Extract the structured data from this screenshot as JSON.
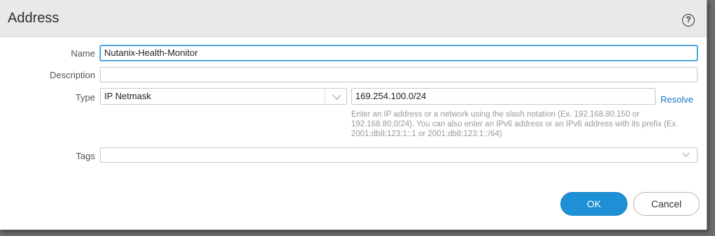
{
  "dialog": {
    "title": "Address",
    "help_glyph": "?"
  },
  "form": {
    "name_label": "Name",
    "name_value": "Nutanix-Health-Monitor",
    "description_label": "Description",
    "description_value": "",
    "type_label": "Type",
    "type_selected": "IP Netmask",
    "type_value": "169.254.100.0/24",
    "resolve_label": "Resolve",
    "hint": "Enter an IP address or a network using the slash notation (Ex. 192.168.80.150 or 192.168.80.0/24). You can also enter an IPv6 address or an IPv6 address with its prefix (Ex. 2001:db8:123:1::1 or 2001:db8:123:1::/64)",
    "tags_label": "Tags",
    "tags_value": ""
  },
  "buttons": {
    "ok_label": "OK",
    "cancel_label": "Cancel"
  },
  "colors": {
    "accent": "#1e90d6",
    "link": "#1a73c8",
    "titlebar": "#e9e9ea"
  }
}
